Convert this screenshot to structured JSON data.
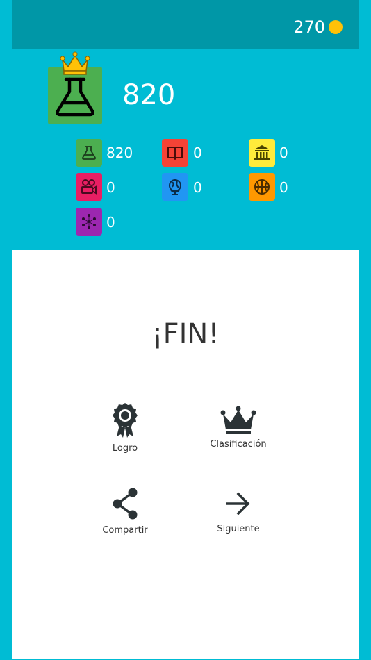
{
  "header": {
    "coins": "270",
    "coin_icon": "gold-coin-icon"
  },
  "player": {
    "main_category_icon": "flask-icon",
    "main_score": "820",
    "badge_icon": "crown-icon"
  },
  "categories": [
    {
      "icon": "flask-icon",
      "color": "#4CAF50",
      "score": "820"
    },
    {
      "icon": "book-icon",
      "color": "#F44336",
      "score": "0"
    },
    {
      "icon": "museum-icon",
      "color": "#FFEB3B",
      "score": "0"
    },
    {
      "icon": "film-camera-icon",
      "color": "#E91E63",
      "score": "0"
    },
    {
      "icon": "globe-icon",
      "color": "#2196F3",
      "score": "0"
    },
    {
      "icon": "basketball-icon",
      "color": "#FF9800",
      "score": "0"
    },
    {
      "icon": "network-icon",
      "color": "#9C27B0",
      "score": "0"
    }
  ],
  "result": {
    "title": "¡FIN!",
    "actions": {
      "achievement": "Logro",
      "ranking": "Clasificación",
      "share": "Compartir",
      "next": "Siguiente"
    }
  }
}
